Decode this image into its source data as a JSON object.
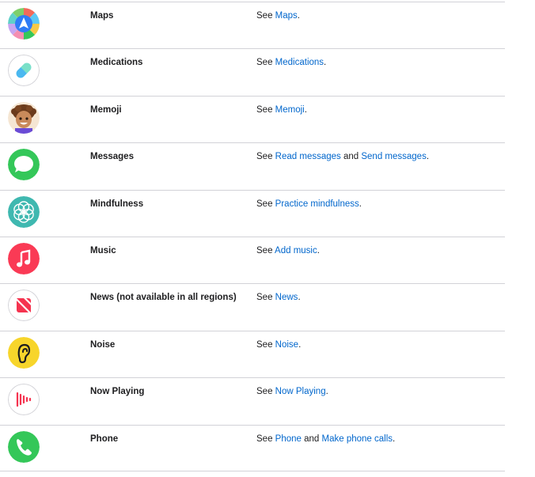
{
  "rows": [
    {
      "name": "Maps",
      "icon": "maps-icon",
      "parts": [
        {
          "text": "See ",
          "link": false
        },
        {
          "text": "Maps",
          "link": true
        },
        {
          "text": ".",
          "link": false
        }
      ]
    },
    {
      "name": "Medications",
      "icon": "medications-icon",
      "parts": [
        {
          "text": "See ",
          "link": false
        },
        {
          "text": "Medications",
          "link": true
        },
        {
          "text": ".",
          "link": false
        }
      ]
    },
    {
      "name": "Memoji",
      "icon": "memoji-icon",
      "parts": [
        {
          "text": "See ",
          "link": false
        },
        {
          "text": "Memoji",
          "link": true
        },
        {
          "text": ".",
          "link": false
        }
      ]
    },
    {
      "name": "Messages",
      "icon": "messages-icon",
      "parts": [
        {
          "text": "See ",
          "link": false
        },
        {
          "text": "Read messages",
          "link": true
        },
        {
          "text": " and ",
          "link": false
        },
        {
          "text": "Send messages",
          "link": true
        },
        {
          "text": ".",
          "link": false
        }
      ]
    },
    {
      "name": "Mindfulness",
      "icon": "mindfulness-icon",
      "parts": [
        {
          "text": "See ",
          "link": false
        },
        {
          "text": "Practice mindfulness",
          "link": true
        },
        {
          "text": ".",
          "link": false
        }
      ]
    },
    {
      "name": "Music",
      "icon": "music-icon",
      "parts": [
        {
          "text": "See ",
          "link": false
        },
        {
          "text": "Add music",
          "link": true
        },
        {
          "text": ".",
          "link": false
        }
      ]
    },
    {
      "name": "News (not available in all regions)",
      "icon": "news-icon",
      "parts": [
        {
          "text": "See ",
          "link": false
        },
        {
          "text": "News",
          "link": true
        },
        {
          "text": ".",
          "link": false
        }
      ]
    },
    {
      "name": "Noise",
      "icon": "noise-icon",
      "parts": [
        {
          "text": "See ",
          "link": false
        },
        {
          "text": "Noise",
          "link": true
        },
        {
          "text": ".",
          "link": false
        }
      ]
    },
    {
      "name": "Now Playing",
      "icon": "now-playing-icon",
      "parts": [
        {
          "text": "See ",
          "link": false
        },
        {
          "text": "Now Playing",
          "link": true
        },
        {
          "text": ".",
          "link": false
        }
      ]
    },
    {
      "name": "Phone",
      "icon": "phone-icon",
      "parts": [
        {
          "text": "See ",
          "link": false
        },
        {
          "text": "Phone",
          "link": true
        },
        {
          "text": " and ",
          "link": false
        },
        {
          "text": "Make phone calls",
          "link": true
        },
        {
          "text": ".",
          "link": false
        }
      ]
    }
  ],
  "colors": {
    "link": "#0066cc",
    "text": "#1d1d1f",
    "divider": "#d2d2d7"
  }
}
